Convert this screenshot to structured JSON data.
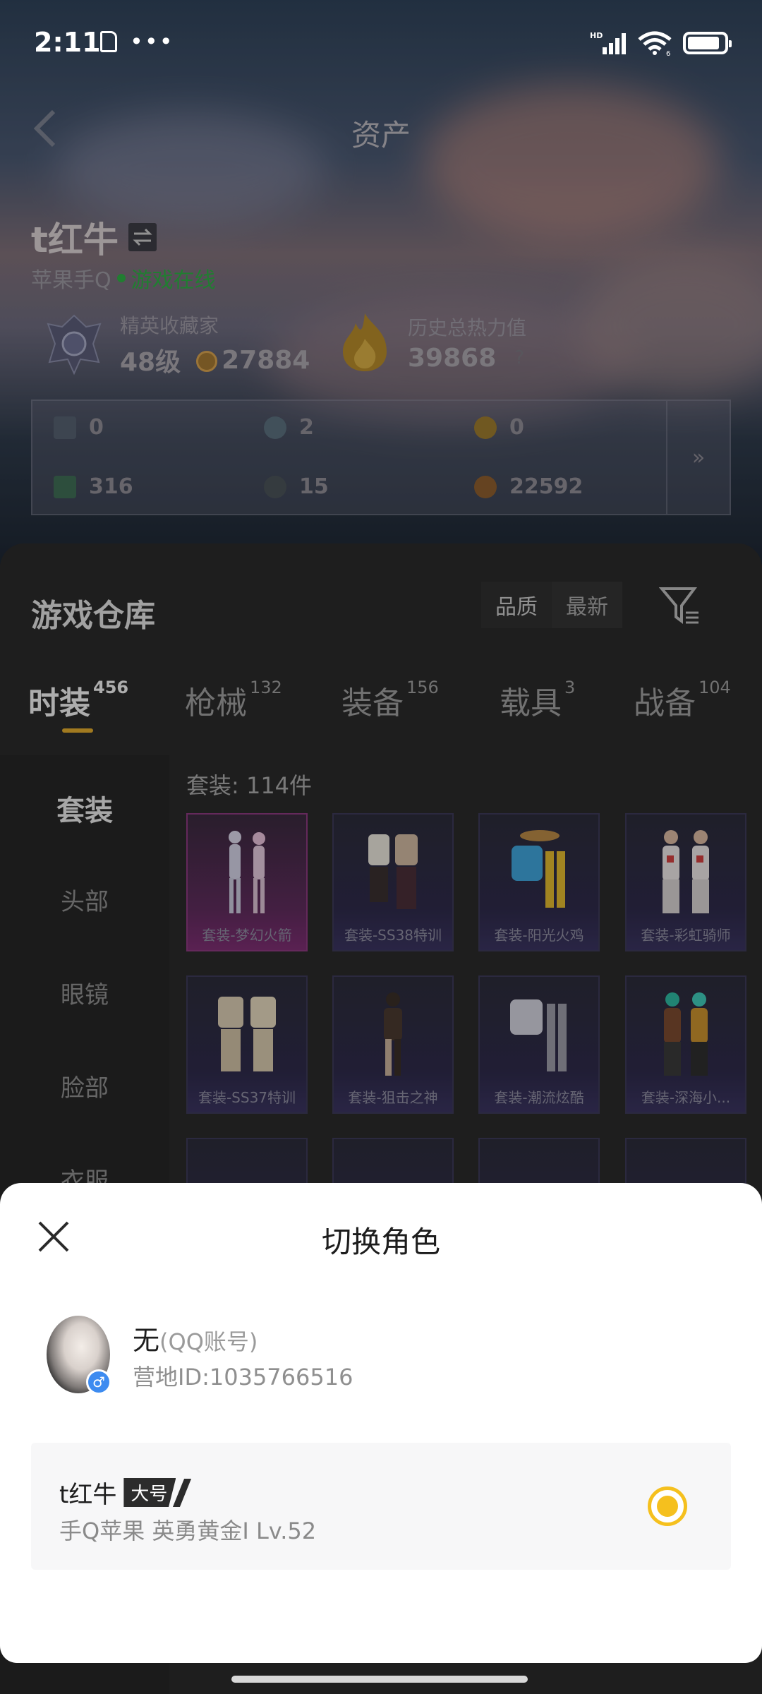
{
  "status_bar": {
    "time": "2:11",
    "network": "HD",
    "wifi_sub": "6"
  },
  "header": {
    "title": "资产"
  },
  "profile": {
    "name": "t红牛",
    "platform": "苹果手Q",
    "online_status": "游戏在线",
    "rank_title": "精英收藏家",
    "rank_level": "48级",
    "rank_points": "27884",
    "power_title": "历史总热力值",
    "power_value": "39868",
    "power_help": "?"
  },
  "currencies": [
    {
      "value": "0",
      "icon": "card-icon",
      "color": "#556070"
    },
    {
      "value": "2",
      "icon": "coin-blue-icon",
      "color": "#5a6f7d"
    },
    {
      "value": "0",
      "icon": "coin-gold-icon",
      "color": "#9c7a2e"
    },
    {
      "value": "316",
      "icon": "ticket-green-icon",
      "color": "#3f6d55"
    },
    {
      "value": "15",
      "icon": "coin-dark-icon",
      "color": "#4a5358"
    },
    {
      "value": "22592",
      "icon": "coin-bronze-icon",
      "color": "#8c5d2e"
    }
  ],
  "currency_more": "»",
  "warehouse": {
    "title": "游戏仓库",
    "sort_quality": "品质",
    "sort_latest": "最新",
    "tabs": [
      {
        "label": "时装",
        "count": "456"
      },
      {
        "label": "枪械",
        "count": "132"
      },
      {
        "label": "装备",
        "count": "156"
      },
      {
        "label": "载具",
        "count": "3"
      },
      {
        "label": "战备",
        "count": "104"
      }
    ],
    "sidebar": [
      "套装",
      "头部",
      "眼镜",
      "脸部",
      "衣服"
    ],
    "grid_label": "套装: 114件",
    "cards": [
      "套装-梦幻火箭",
      "套装-SS38特训",
      "套装-阳光火鸡",
      "套装-彩虹骑师",
      "套装-SS37特训",
      "套装-狙击之神",
      "套装-潮流炫酷",
      "套装-深海小...",
      "",
      "",
      "",
      ""
    ]
  },
  "sheet": {
    "title": "切换角色",
    "account_name": "无",
    "account_type": "(QQ账号)",
    "account_id": "营地ID:1035766516",
    "gender": "♂",
    "role_name": "t红牛",
    "role_tag": "大号",
    "role_info": "手Q苹果  英勇黄金I  Lv.52"
  },
  "colors": {
    "accent": "#f5c01e",
    "online": "#2fae45",
    "tab_underline": "#e0a92d"
  }
}
